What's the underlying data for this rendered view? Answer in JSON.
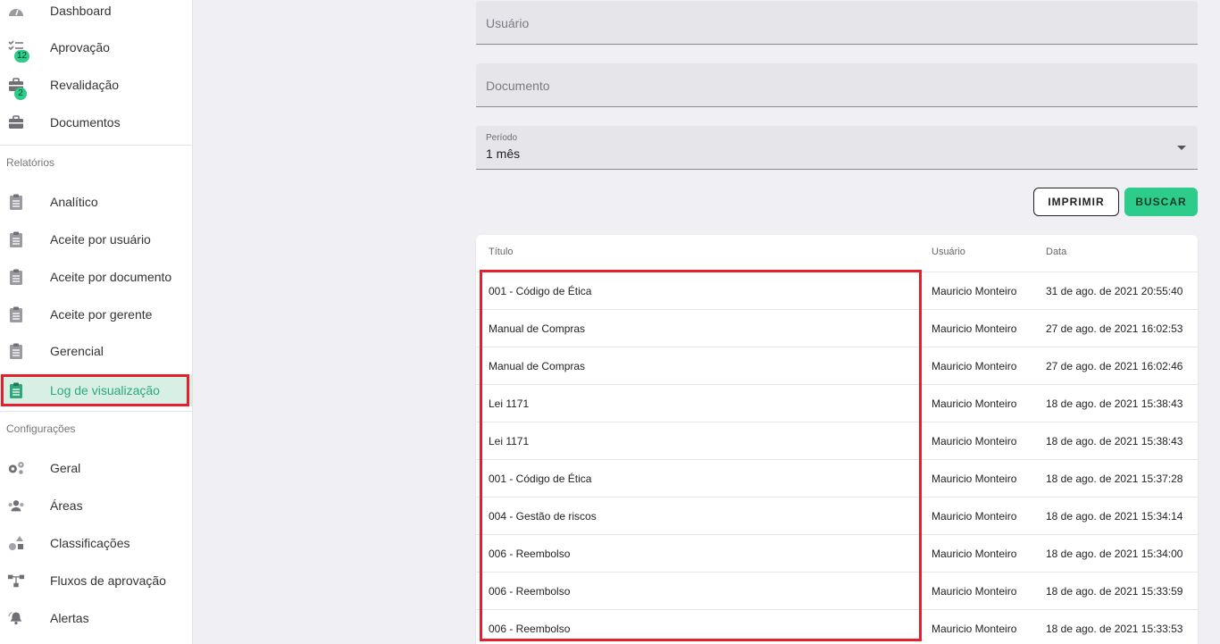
{
  "sidebar": {
    "top_items": [
      {
        "label": "Dashboard",
        "icon": "gauge-icon"
      },
      {
        "label": "Aprovação",
        "icon": "checklist-icon",
        "badge": "12"
      },
      {
        "label": "Revalidação",
        "icon": "briefcase-icon",
        "badge": "2"
      },
      {
        "label": "Documentos",
        "icon": "briefcase-icon"
      }
    ],
    "reports_title": "Relatórios",
    "report_items": [
      {
        "label": "Analítico"
      },
      {
        "label": "Aceite por usuário"
      },
      {
        "label": "Aceite por documento"
      },
      {
        "label": "Aceite por gerente"
      },
      {
        "label": "Gerencial"
      },
      {
        "label": "Log de visualização",
        "active": true
      }
    ],
    "config_title": "Configurações",
    "config_items": [
      {
        "label": "Geral",
        "icon": "gears-icon"
      },
      {
        "label": "Áreas",
        "icon": "users-icon"
      },
      {
        "label": "Classificações",
        "icon": "shapes-icon"
      },
      {
        "label": "Fluxos de aprovação",
        "icon": "flow-icon"
      },
      {
        "label": "Alertas",
        "icon": "bell-icon"
      }
    ]
  },
  "form": {
    "user_placeholder": "Usuário",
    "document_placeholder": "Documento",
    "period_label": "Período",
    "period_value": "1 mês",
    "print_label": "IMPRIMIR",
    "search_label": "BUSCAR"
  },
  "table": {
    "headers": {
      "title": "Título",
      "user": "Usuário",
      "date": "Data"
    },
    "rows": [
      {
        "title": "001 - Código de Ética",
        "user": "Mauricio Monteiro",
        "date": "31 de ago. de 2021 20:55:40"
      },
      {
        "title": "Manual de Compras",
        "user": "Mauricio Monteiro",
        "date": "27 de ago. de 2021 16:02:53"
      },
      {
        "title": "Manual de Compras",
        "user": "Mauricio Monteiro",
        "date": "27 de ago. de 2021 16:02:46"
      },
      {
        "title": "Lei 1171",
        "user": "Mauricio Monteiro",
        "date": "18 de ago. de 2021 15:38:43"
      },
      {
        "title": "Lei 1171",
        "user": "Mauricio Monteiro",
        "date": "18 de ago. de 2021 15:38:43"
      },
      {
        "title": "001 - Código de Ética",
        "user": "Mauricio Monteiro",
        "date": "18 de ago. de 2021 15:37:28"
      },
      {
        "title": "004 - Gestão de riscos",
        "user": "Mauricio Monteiro",
        "date": "18 de ago. de 2021 15:34:14"
      },
      {
        "title": "006 - Reembolso",
        "user": "Mauricio Monteiro",
        "date": "18 de ago. de 2021 15:34:00"
      },
      {
        "title": "006 - Reembolso",
        "user": "Mauricio Monteiro",
        "date": "18 de ago. de 2021 15:33:59"
      },
      {
        "title": "006 - Reembolso",
        "user": "Mauricio Monteiro",
        "date": "18 de ago. de 2021 15:33:53"
      }
    ]
  },
  "colors": {
    "accent": "#2ecc8a",
    "highlight": "#e3202b",
    "active_bg": "#d7efe5"
  }
}
